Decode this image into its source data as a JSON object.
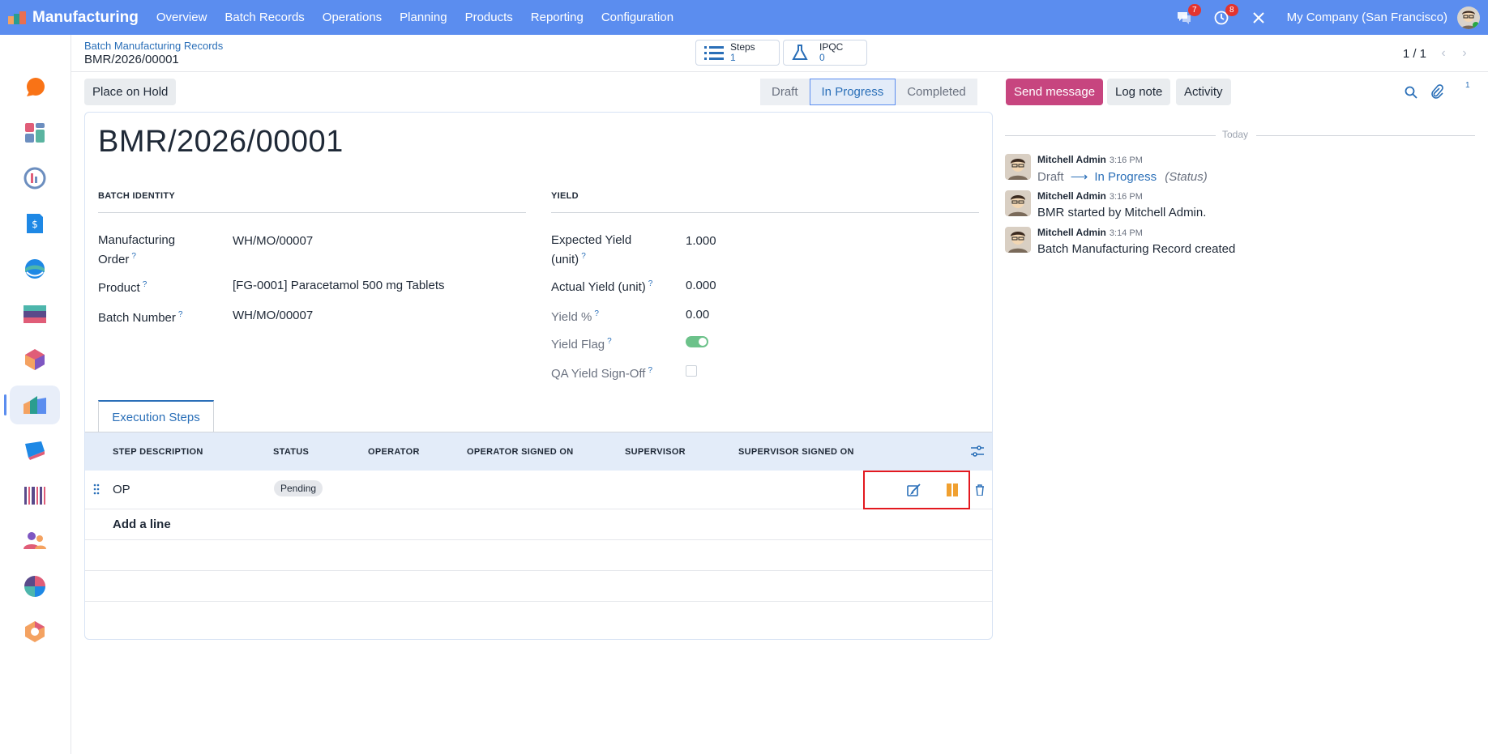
{
  "app": {
    "name": "Manufacturing"
  },
  "nav": {
    "items": [
      "Overview",
      "Batch Records",
      "Operations",
      "Planning",
      "Products",
      "Reporting",
      "Configuration"
    ]
  },
  "systray": {
    "messages_badge": "7",
    "activities_badge": "8",
    "company": "My Company (San Francisco)"
  },
  "breadcrumb": {
    "parent": "Batch Manufacturing Records",
    "current": "BMR/2026/00001"
  },
  "smart_buttons": {
    "steps_label": "Steps",
    "steps_count": "1",
    "ipqc_label": "IPQC",
    "ipqc_count": "0"
  },
  "pager": {
    "value": "1 / 1"
  },
  "actions": {
    "place_on_hold": "Place on Hold"
  },
  "statusbar": {
    "stages": [
      "Draft",
      "In Progress",
      "Completed"
    ],
    "active": "In Progress"
  },
  "record": {
    "title": "BMR/2026/00001",
    "sections": {
      "identity": "BATCH IDENTITY",
      "yield": "YIELD"
    },
    "fields": {
      "mo_label": "Manufacturing Order",
      "mo_value": "WH/MO/00007",
      "product_label": "Product",
      "product_value": "[FG-0001] Paracetamol 500 mg Tablets",
      "batch_label": "Batch Number",
      "batch_value": "WH/MO/00007",
      "expected_yield_label": "Expected Yield (unit)",
      "expected_yield_value": "1.000",
      "actual_yield_label": "Actual Yield (unit)",
      "actual_yield_value": "0.000",
      "yield_pct_label": "Yield %",
      "yield_pct_value": "0.00",
      "yield_flag_label": "Yield Flag",
      "yield_flag_value": true,
      "qa_signoff_label": "QA Yield Sign-Off",
      "qa_signoff_value": false
    }
  },
  "tabs": {
    "execution_steps": "Execution Steps"
  },
  "steps_table": {
    "columns": [
      "STEP DESCRIPTION",
      "STATUS",
      "OPERATOR",
      "OPERATOR SIGNED ON",
      "SUPERVISOR",
      "SUPERVISOR SIGNED ON"
    ],
    "rows": [
      {
        "description": "OP",
        "status": "Pending"
      }
    ],
    "add_line": "Add a line"
  },
  "chatter": {
    "send_message": "Send message",
    "log_note": "Log note",
    "activity": "Activity",
    "followers_count": "1",
    "date_separator": "Today",
    "messages": [
      {
        "author": "Mitchell Admin",
        "time": "3:16 PM",
        "from": "Draft",
        "to": "In Progress",
        "field": "(Status)"
      },
      {
        "author": "Mitchell Admin",
        "time": "3:16 PM",
        "body": "BMR started by Mitchell Admin."
      },
      {
        "author": "Mitchell Admin",
        "time": "3:14 PM",
        "body": "Batch Manufacturing Record created"
      }
    ]
  },
  "colors": {
    "navbar": "#5b8def",
    "accent": "#2a6fb8",
    "primary_button": "#c7457f",
    "highlight_box": "#e3191f"
  }
}
